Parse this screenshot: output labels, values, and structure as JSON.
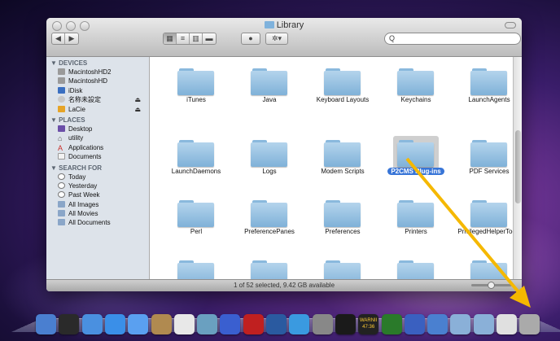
{
  "window": {
    "title": "Library",
    "search_placeholder": "",
    "status_text": "1 of 52 selected, 9.42 GB available"
  },
  "sidebar": {
    "devices_header": "▼ DEVICES",
    "devices": [
      {
        "label": "MacintoshHD2",
        "icon": "hard-drive-icon"
      },
      {
        "label": "MacintoshHD",
        "icon": "hard-drive-icon"
      },
      {
        "label": "iDisk",
        "icon": "idisk-icon"
      },
      {
        "label": "名称未設定",
        "icon": "disc-icon",
        "eject": true
      },
      {
        "label": "LaCie",
        "icon": "external-drive-icon",
        "eject": true
      }
    ],
    "places_header": "▼ PLACES",
    "places": [
      {
        "label": "Desktop",
        "icon": "desktop-icon"
      },
      {
        "label": "utility",
        "icon": "home-icon"
      },
      {
        "label": "Applications",
        "icon": "applications-icon"
      },
      {
        "label": "Documents",
        "icon": "documents-icon"
      }
    ],
    "search_header": "▼ SEARCH FOR",
    "searches": [
      {
        "label": "Today",
        "icon": "clock-icon"
      },
      {
        "label": "Yesterday",
        "icon": "clock-icon"
      },
      {
        "label": "Past Week",
        "icon": "clock-icon"
      },
      {
        "label": "All Images",
        "icon": "smart-folder-icon"
      },
      {
        "label": "All Movies",
        "icon": "smart-folder-icon"
      },
      {
        "label": "All Documents",
        "icon": "smart-folder-icon"
      }
    ]
  },
  "folders": [
    {
      "label": "iTunes"
    },
    {
      "label": "Java"
    },
    {
      "label": "Keyboard Layouts"
    },
    {
      "label": "Keychains"
    },
    {
      "label": "LaunchAgents"
    },
    {
      "label": "LaunchDaemons"
    },
    {
      "label": "Logs"
    },
    {
      "label": "Modem Scripts"
    },
    {
      "label": "P2CMS Plug-ins",
      "selected": true
    },
    {
      "label": "PDF Services"
    },
    {
      "label": "Perl"
    },
    {
      "label": "PreferencePanes"
    },
    {
      "label": "Preferences"
    },
    {
      "label": "Printers"
    },
    {
      "label": "PrivilegedHelperTools"
    },
    {
      "label": ""
    },
    {
      "label": ""
    },
    {
      "label": ""
    },
    {
      "label": ""
    },
    {
      "label": ""
    }
  ],
  "colors": {
    "selection": "#3875d7",
    "arrow": "#f5b800",
    "sidebar_bg": "#dde3ea"
  },
  "dock": {
    "icons": [
      "finder-icon",
      "dashboard-icon",
      "mail-icon",
      "safari-icon",
      "ichat-icon",
      "address-book-icon",
      "ical-icon",
      "preview-icon",
      "itunes-icon",
      "photo-icon",
      "time-machine-icon",
      "safari2-icon",
      "system-preferences-icon",
      "terminal-icon",
      "console-icon",
      "activity-monitor-icon",
      "xcode-icon",
      "finder2-icon",
      "folder-icon",
      "downloads-icon",
      "documents-stack-icon",
      "trash-icon"
    ],
    "console_text": "WARNII",
    "console_time": "47:36"
  }
}
